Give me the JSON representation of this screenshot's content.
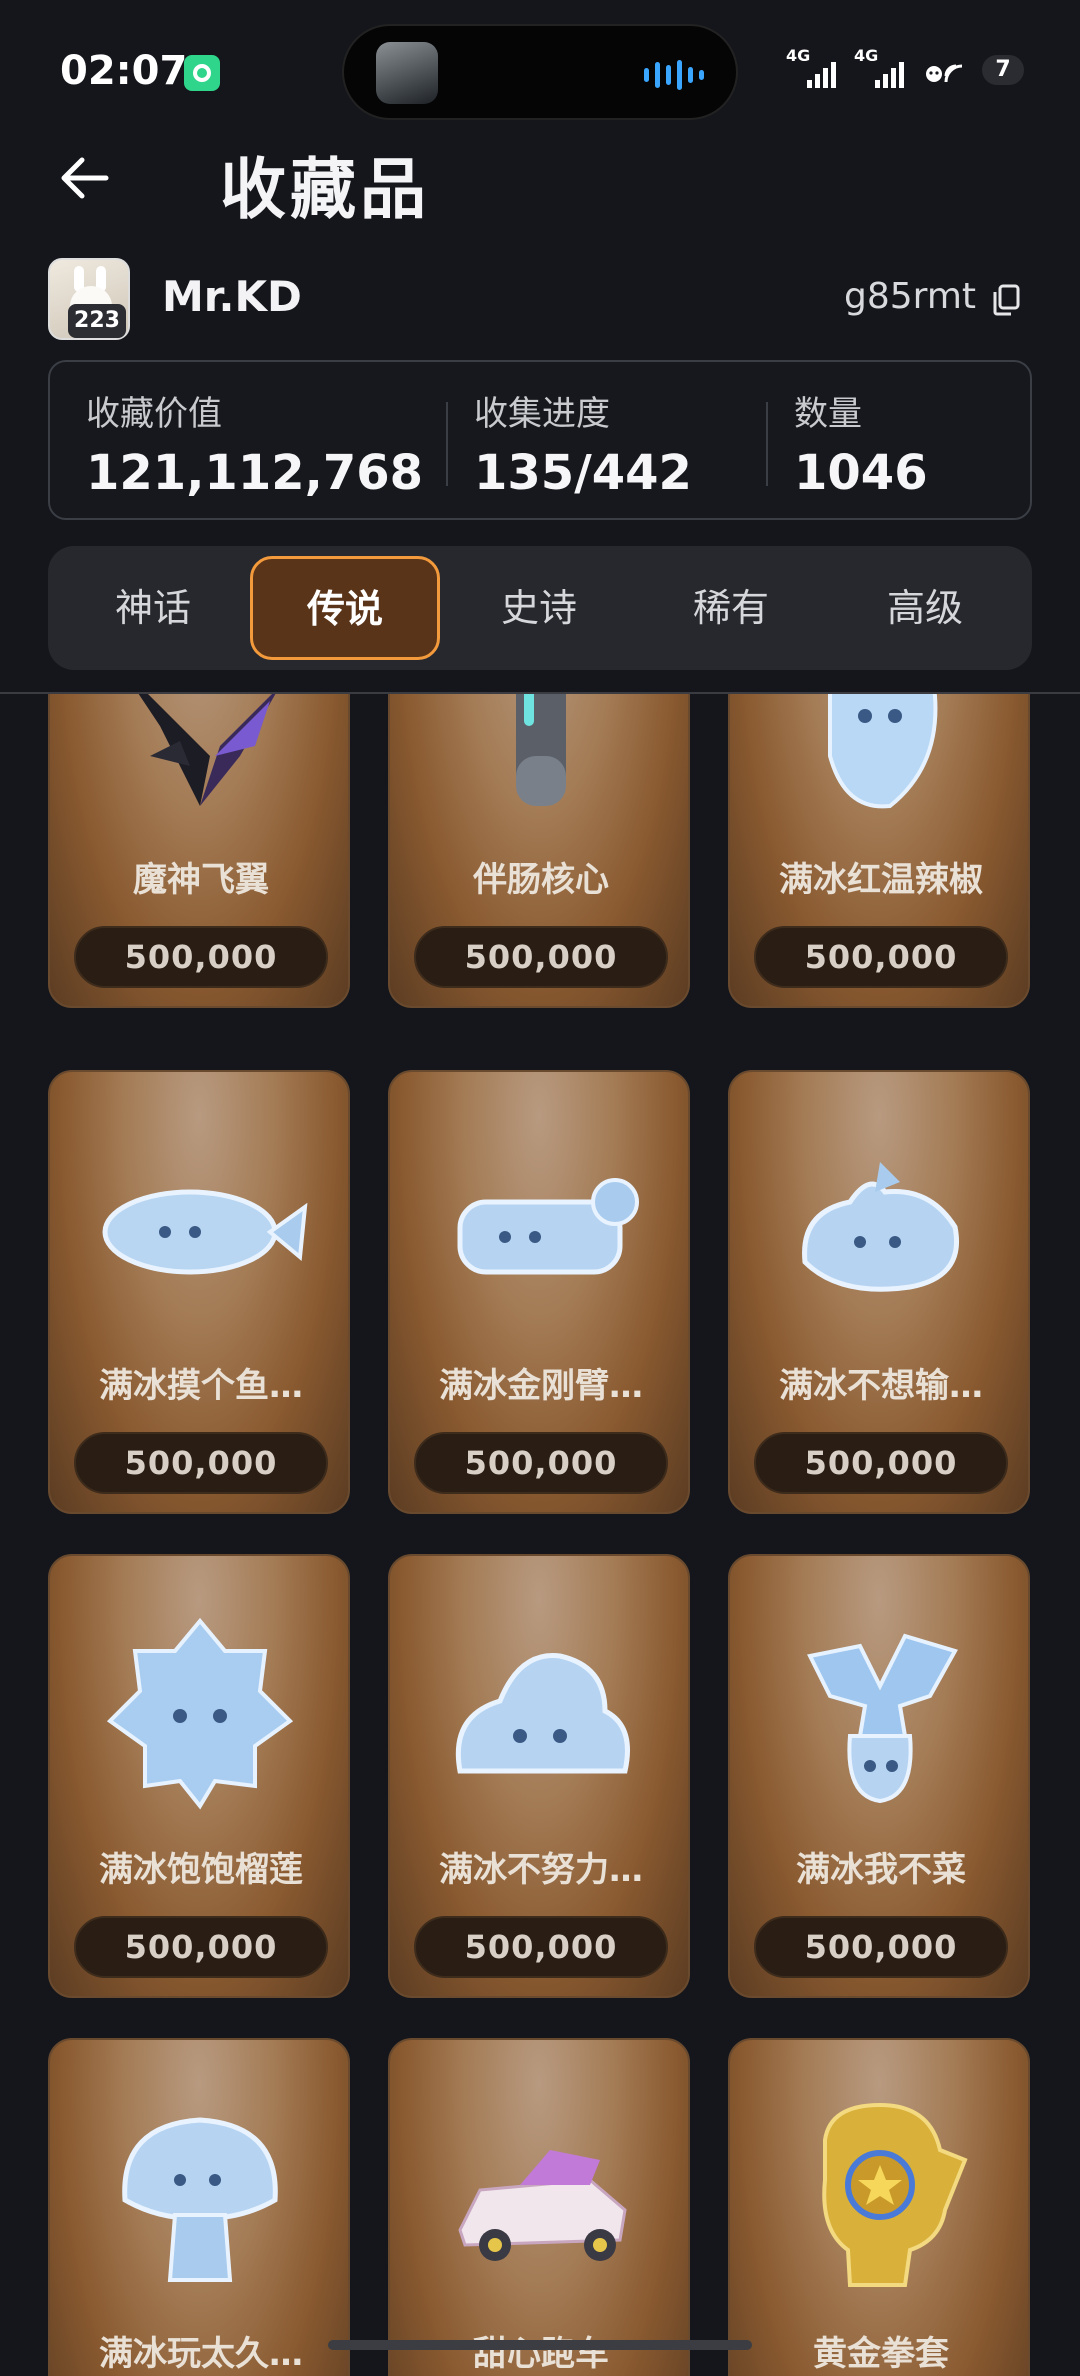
{
  "status_bar": {
    "time": "02:07",
    "signal1": "4G",
    "signal2": "4G",
    "battery": "7"
  },
  "header": {
    "title": "收藏品"
  },
  "user": {
    "name": "Mr.KD",
    "level": "223",
    "uid": "g85rmt"
  },
  "stats": [
    {
      "label": "收藏价值",
      "value": "121,112,768"
    },
    {
      "label": "收集进度",
      "value": "135/442"
    },
    {
      "label": "数量",
      "value": "1046"
    }
  ],
  "tabs": [
    {
      "label": "神话",
      "active": false
    },
    {
      "label": "传说",
      "active": true
    },
    {
      "label": "史诗",
      "active": false
    },
    {
      "label": "稀有",
      "active": false
    },
    {
      "label": "高级",
      "active": false
    }
  ],
  "items": [
    {
      "name": "魔神飞翼",
      "price": "500,000",
      "icon": "demon-wing-icon"
    },
    {
      "name": "伴肠核心",
      "price": "500,000",
      "icon": "capsule-core-icon"
    },
    {
      "name": "满冰红温辣椒",
      "price": "500,000",
      "icon": "ice-pepper-icon"
    },
    {
      "name": "满冰摸个鱼…",
      "price": "500,000",
      "icon": "ice-fish-icon"
    },
    {
      "name": "满冰金刚臂…",
      "price": "500,000",
      "icon": "ice-arm-icon"
    },
    {
      "name": "满冰不想输…",
      "price": "500,000",
      "icon": "ice-blob-icon"
    },
    {
      "name": "满冰饱饱榴莲",
      "price": "500,000",
      "icon": "ice-durian-icon"
    },
    {
      "name": "满冰不努力…",
      "price": "500,000",
      "icon": "ice-slime-icon"
    },
    {
      "name": "满冰我不菜",
      "price": "500,000",
      "icon": "ice-veggie-icon"
    },
    {
      "name": "满冰玩太久…",
      "price": "",
      "icon": "ice-mushroom-icon"
    },
    {
      "name": "甜心跑车",
      "price": "",
      "icon": "sweet-car-icon"
    },
    {
      "name": "黄金拳套",
      "price": "",
      "icon": "golden-glove-icon"
    }
  ]
}
